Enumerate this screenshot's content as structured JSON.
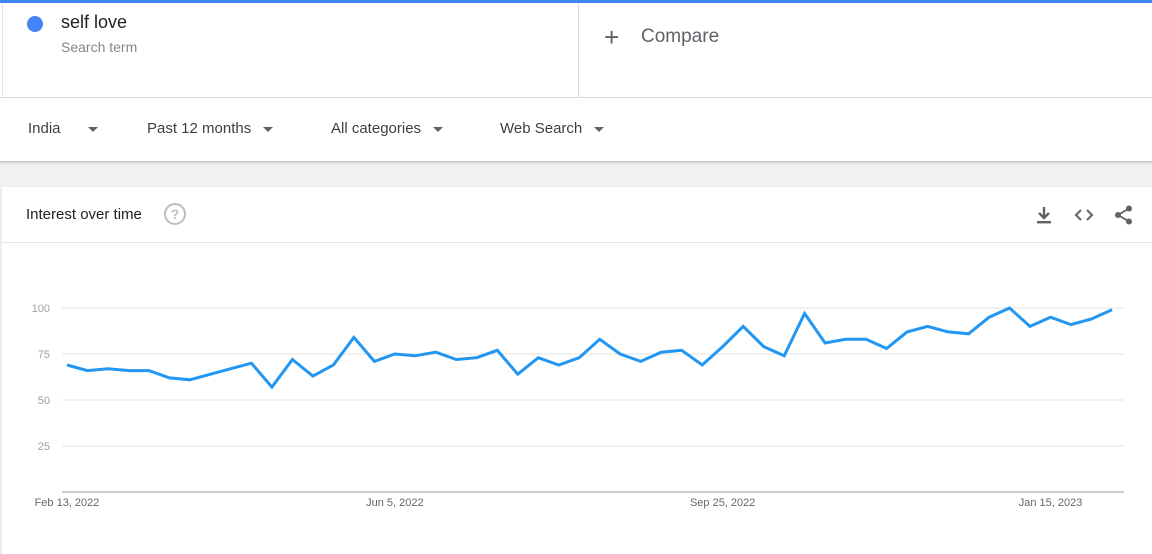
{
  "search_term": {
    "name": "self love",
    "subtitle": "Search term",
    "color": "#4285f4"
  },
  "compare": {
    "label": "Compare"
  },
  "filters": {
    "region": "India",
    "time": "Past 12 months",
    "category": "All categories",
    "search_type": "Web Search"
  },
  "card": {
    "title": "Interest over time",
    "tools": [
      "download-icon",
      "embed-icon",
      "share-icon"
    ]
  },
  "chart_data": {
    "type": "line",
    "title": "Interest over time",
    "series": [
      {
        "name": "self love",
        "color": "#2196f3",
        "values": [
          69,
          66,
          67,
          66,
          66,
          62,
          61,
          64,
          67,
          70,
          57,
          72,
          63,
          69,
          84,
          71,
          75,
          74,
          76,
          72,
          73,
          77,
          64,
          73,
          69,
          73,
          83,
          75,
          71,
          76,
          77,
          69,
          79,
          90,
          79,
          74,
          97,
          81,
          83,
          83,
          78,
          87,
          90,
          87,
          86,
          95,
          100,
          90,
          95,
          91,
          94,
          99
        ]
      }
    ],
    "x_tick_labels": [
      "Feb 13, 2022",
      "Jun 5, 2022",
      "Sep 25, 2022",
      "Jan 15, 2023"
    ],
    "x_tick_index": [
      0,
      16,
      32,
      48
    ],
    "y_ticks": [
      25,
      50,
      75,
      100
    ],
    "ylim": [
      0,
      100
    ],
    "grid": true
  }
}
